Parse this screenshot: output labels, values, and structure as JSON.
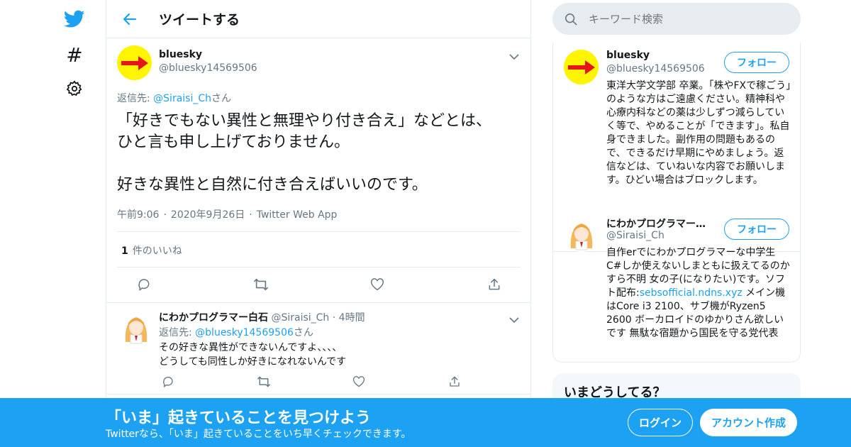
{
  "nav": {
    "icons": [
      "twitter-logo-icon",
      "hashtag-icon",
      "gear-icon"
    ],
    "hash_glyph": "#"
  },
  "header": {
    "title": "ツイートする",
    "back_icon": "arrow-left-icon"
  },
  "tweet": {
    "name": "bluesky",
    "handle": "@bluesky14569506",
    "reply_prefix": "返信先: ",
    "reply_handle": "@Siraisi_Ch",
    "reply_suffix": "さん",
    "body_line1": "「好きでもない異性と無理やり付き合え」などとは、",
    "body_line2": "ひと言も申し上げておりません。",
    "body_line3": "好きな異性と自然に付き合えばいいのです。",
    "time": "午前9:06",
    "date": "2020年9月26日",
    "source": "Twitter Web App",
    "dot": "·",
    "like_count": "1",
    "like_label": "件のいいね"
  },
  "reply": {
    "name": "にわかプログラマー白石",
    "handle": "@Siraisi_Ch",
    "dot": "·",
    "time": "4時間",
    "reply_prefix": "返信先: ",
    "reply_handle": "@bluesky14569506",
    "reply_suffix": "さん",
    "body_line1": "その好きな異性ができないんですよ、、、、",
    "body_line2": "どうしても同性しか好きになれないんです"
  },
  "search": {
    "placeholder": "キーワード検索"
  },
  "profiles": [
    {
      "name": "bluesky",
      "handle": "@bluesky14569506",
      "follow_label": "フォロー",
      "bio": "東洋大学文学部 卒業。「株やFXで稼ごう」のような方はご遠慮ください。精神科や心療内科などの薬は少しずつ減らしていく等で、やめることが「できます」。私自身できました。副作用の問題もあるので、できるだけ早期にやめましょう。返信などは、ていねいな内容でお願いします。ひどい場合はブロックします。"
    },
    {
      "name": "にわかプログラマー…",
      "handle": "@Siraisi_Ch",
      "follow_label": "フォロー",
      "bio_before": "自作erでにわかプログラマーな中学生 C#しか使えないしまともに扱えてるのかすら不明 女の子(になりたい)です。ソフト配布:",
      "bio_link": "sebsofficial.ndns.xyz",
      "bio_after": " メイン機はCore i3 2100、サブ機がRyzen5 2600 ボーカロイドのゆかりさん欲しいです 無駄な宿題から国民を守る党代表"
    }
  ],
  "trends": {
    "title": "いまどうしてる？"
  },
  "bottom_bar": {
    "title": "「いま」起きていることを見つけよう",
    "subtitle": "Twitterなら、「いま」起きていることをいち早くチェックできます。",
    "login_label": "ログイン",
    "signup_label": "アカウント作成"
  },
  "colors": {
    "accent": "#1da1f2",
    "text": "#14171a",
    "muted": "#657786",
    "border": "#e6ecf0",
    "avatar_yellow": "#fff500",
    "arrow_red": "#e8141c"
  }
}
